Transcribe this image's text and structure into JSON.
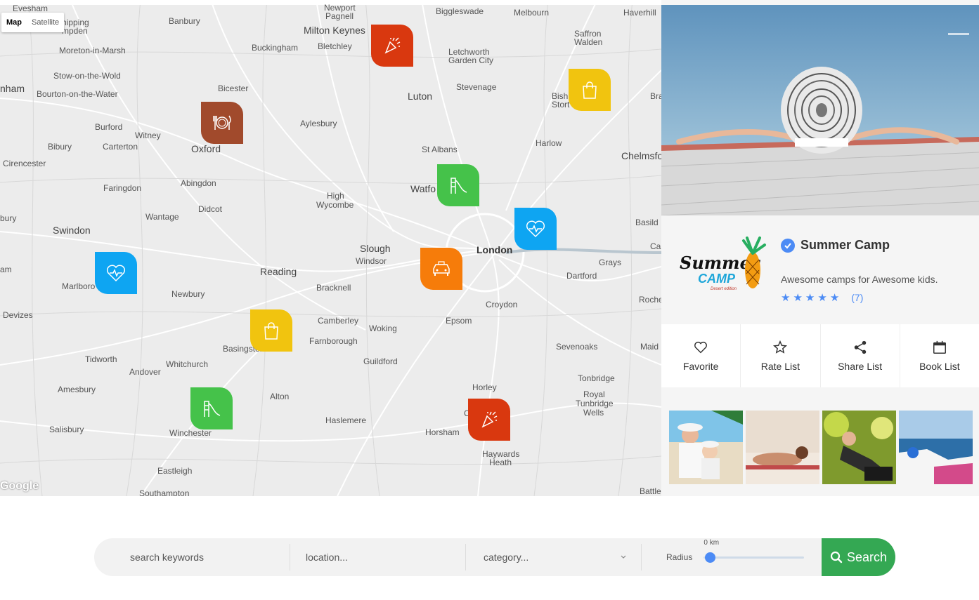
{
  "map": {
    "type_controls": [
      "Map",
      "Satellite"
    ],
    "attribution": "Google",
    "places": [
      {
        "name": "Evesham",
        "cls": ""
      },
      {
        "name": "Newport",
        "cls": ""
      },
      {
        "name": "Pagnell",
        "cls": ""
      },
      {
        "name": "Biggleswade",
        "cls": ""
      },
      {
        "name": "Melbourn",
        "cls": ""
      },
      {
        "name": "Haverhill",
        "cls": ""
      },
      {
        "name": "Banbury",
        "cls": ""
      },
      {
        "name": "Milton Keynes",
        "cls": "big"
      },
      {
        "name": "hipping",
        "cls": ""
      },
      {
        "name": "mpden",
        "cls": ""
      },
      {
        "name": "Buckingham",
        "cls": ""
      },
      {
        "name": "Bletchley",
        "cls": ""
      },
      {
        "name": "Saffron",
        "cls": ""
      },
      {
        "name": "Walden",
        "cls": ""
      },
      {
        "name": "Moreton-in-Marsh",
        "cls": ""
      },
      {
        "name": "Letchworth",
        "cls": ""
      },
      {
        "name": "Garden City",
        "cls": ""
      },
      {
        "name": "Stow-on-the-Wold",
        "cls": ""
      },
      {
        "name": "nham",
        "cls": "big"
      },
      {
        "name": "Bicester",
        "cls": ""
      },
      {
        "name": "Stevenage",
        "cls": ""
      },
      {
        "name": "Luton",
        "cls": "big"
      },
      {
        "name": "Bourton-on-the-Water",
        "cls": ""
      },
      {
        "name": "Bish",
        "cls": ""
      },
      {
        "name": "Stort",
        "cls": ""
      },
      {
        "name": "Bra",
        "cls": ""
      },
      {
        "name": "Aylesbury",
        "cls": ""
      },
      {
        "name": "Burford",
        "cls": ""
      },
      {
        "name": "Witney",
        "cls": ""
      },
      {
        "name": "Bibury",
        "cls": ""
      },
      {
        "name": "Carterton",
        "cls": ""
      },
      {
        "name": "Oxford",
        "cls": "big"
      },
      {
        "name": "Harlow",
        "cls": ""
      },
      {
        "name": "St Albans",
        "cls": ""
      },
      {
        "name": "Chelmsfo",
        "cls": "big"
      },
      {
        "name": "Cirencester",
        "cls": ""
      },
      {
        "name": "Abingdon",
        "cls": ""
      },
      {
        "name": "Faringdon",
        "cls": ""
      },
      {
        "name": "Watfo",
        "cls": "big"
      },
      {
        "name": "High",
        "cls": ""
      },
      {
        "name": "Wycombe",
        "cls": ""
      },
      {
        "name": "Didcot",
        "cls": ""
      },
      {
        "name": "Wantage",
        "cls": ""
      },
      {
        "name": "bury",
        "cls": ""
      },
      {
        "name": "Basild",
        "cls": ""
      },
      {
        "name": "Swindon",
        "cls": "big"
      },
      {
        "name": "Slough",
        "cls": "big"
      },
      {
        "name": "Windsor",
        "cls": ""
      },
      {
        "name": "London",
        "cls": "bold"
      },
      {
        "name": "Ca",
        "cls": ""
      },
      {
        "name": "Grays",
        "cls": ""
      },
      {
        "name": "am",
        "cls": ""
      },
      {
        "name": "Reading",
        "cls": "big"
      },
      {
        "name": "Dartford",
        "cls": ""
      },
      {
        "name": "Marlboro",
        "cls": ""
      },
      {
        "name": "Bracknell",
        "cls": ""
      },
      {
        "name": "Newbury",
        "cls": ""
      },
      {
        "name": "Roche",
        "cls": ""
      },
      {
        "name": "Croydon",
        "cls": ""
      },
      {
        "name": "Devizes",
        "cls": ""
      },
      {
        "name": "Camberley",
        "cls": ""
      },
      {
        "name": "Epsom",
        "cls": ""
      },
      {
        "name": "Woking",
        "cls": ""
      },
      {
        "name": "Farnborough",
        "cls": ""
      },
      {
        "name": "Basingstoke",
        "cls": ""
      },
      {
        "name": "Sevenoaks",
        "cls": ""
      },
      {
        "name": "Maid",
        "cls": ""
      },
      {
        "name": "Tidworth",
        "cls": ""
      },
      {
        "name": "Whitchurch",
        "cls": ""
      },
      {
        "name": "Guildford",
        "cls": ""
      },
      {
        "name": "Andover",
        "cls": ""
      },
      {
        "name": "Tonbridge",
        "cls": ""
      },
      {
        "name": "Amesbury",
        "cls": ""
      },
      {
        "name": "Horley",
        "cls": ""
      },
      {
        "name": "Alton",
        "cls": ""
      },
      {
        "name": "Royal",
        "cls": ""
      },
      {
        "name": "Tunbridge",
        "cls": ""
      },
      {
        "name": "Wells",
        "cls": ""
      },
      {
        "name": "Haslemere",
        "cls": ""
      },
      {
        "name": "Salisbury",
        "cls": ""
      },
      {
        "name": "Cr",
        "cls": ""
      },
      {
        "name": "Winchester",
        "cls": ""
      },
      {
        "name": "Horsham",
        "cls": ""
      },
      {
        "name": "Haywards",
        "cls": ""
      },
      {
        "name": "Heath",
        "cls": ""
      },
      {
        "name": "Eastleigh",
        "cls": ""
      },
      {
        "name": "Southampton",
        "cls": ""
      },
      {
        "name": "Battle",
        "cls": ""
      }
    ],
    "markers": [
      {
        "icon": "party-popper-icon",
        "color": "#d9380f"
      },
      {
        "icon": "shopping-bag-icon",
        "color": "#f1c40f"
      },
      {
        "icon": "restaurant-icon",
        "color": "#a14a2c"
      },
      {
        "icon": "playground-slide-icon",
        "color": "#45c24a"
      },
      {
        "icon": "health-heart-icon",
        "color": "#0ea5f2"
      },
      {
        "icon": "health-heart-icon",
        "color": "#0ea5f2"
      },
      {
        "icon": "taxi-icon",
        "color": "#f67c0a"
      },
      {
        "icon": "shopping-bag-icon",
        "color": "#f1c40f"
      },
      {
        "icon": "playground-slide-icon",
        "color": "#45c24a"
      },
      {
        "icon": "party-popper-icon",
        "color": "#d9380f"
      }
    ]
  },
  "listing": {
    "title": "Summer Camp",
    "tagline": "Awesome camps for Awesome kids.",
    "stars": 5,
    "rating_count": "(7)",
    "logo_text_1": "Summer",
    "logo_text_2": "CAMP",
    "logo_text_3": "Desert edition",
    "actions": [
      {
        "label": "Favorite",
        "icon": "heart-icon"
      },
      {
        "label": "Rate List",
        "icon": "star-icon"
      },
      {
        "label": "Share List",
        "icon": "share-icon"
      },
      {
        "label": "Book List",
        "icon": "calendar-icon"
      }
    ],
    "thumbnails": [
      "beach-family-photo",
      "sunbathing-photo",
      "relaxing-woman-photo",
      "santorini-photo"
    ]
  },
  "search": {
    "keywords_placeholder": "search keywords",
    "location_placeholder": "location...",
    "category_value": "category...",
    "radius_label": "Radius",
    "radius_value": "0 km",
    "radius_fraction": 0,
    "button_label": "Search"
  },
  "colors": {
    "accent": "#4c8bf5",
    "search_button": "#34a853"
  }
}
